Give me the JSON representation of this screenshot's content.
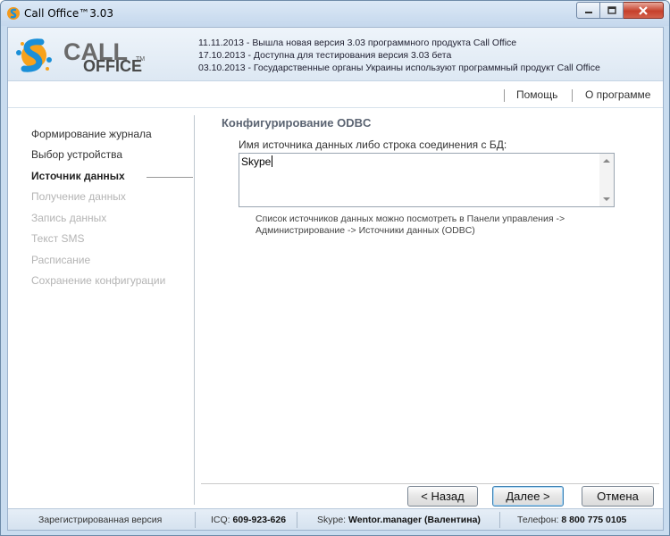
{
  "window": {
    "title": "Call Office™3.03"
  },
  "header": {
    "logo_word1": "CALL",
    "logo_word2": "OFFICE",
    "logo_tm": "TM",
    "news": [
      "11.11.2013 - Вышла новая версия 3.03 программного продукта Call Office",
      "17.10.2013 - Доступна для тестирования версия 3.03 бета",
      "03.10.2013 - Государственные органы Украины используют программный продукт Call Office"
    ]
  },
  "menu": {
    "help": "Помощь",
    "about": "О программе"
  },
  "sidebar": {
    "steps": [
      {
        "label": "Формирование журнала",
        "state": "done"
      },
      {
        "label": "Выбор устройства",
        "state": "done"
      },
      {
        "label": "Источник данных",
        "state": "active"
      },
      {
        "label": "Получение данных",
        "state": "disabled"
      },
      {
        "label": "Запись данных",
        "state": "disabled"
      },
      {
        "label": "Текст SMS",
        "state": "disabled"
      },
      {
        "label": "Расписание",
        "state": "disabled"
      },
      {
        "label": "Сохранение конфигурации",
        "state": "disabled"
      }
    ]
  },
  "main": {
    "section_title": "Конфигурирование ODBC",
    "field_label": "Имя источника данных либо строка соединения с БД:",
    "field_value": "Skype",
    "hint_line1": "Список источников данных можно посмотреть в Панели управления ->",
    "hint_line2": "Администрирование -> Источники данных (ODBC)"
  },
  "buttons": {
    "back": "< Назад",
    "next": "Далее >",
    "cancel": "Отмена"
  },
  "status": {
    "registered": "Зарегистрированная версия",
    "icq_label": "ICQ:",
    "icq_value": "609-923-626",
    "skype_label": "Skype:",
    "skype_value": "Wentor.manager (Валентина)",
    "phone_label": "Телефон:",
    "phone_value": "8 800 775 0105"
  },
  "colors": {
    "accent": "#3c7fb1",
    "disabled_text": "#b4b4b4"
  }
}
